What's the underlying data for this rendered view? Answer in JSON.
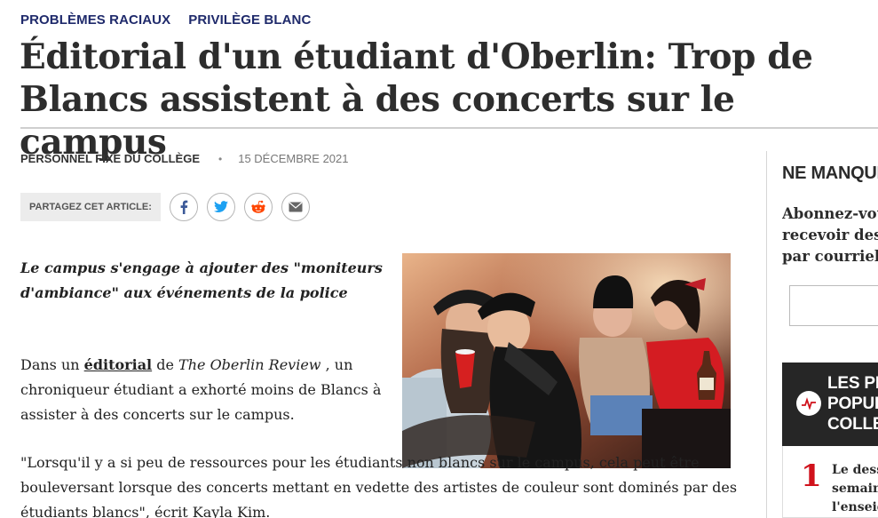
{
  "tags": [
    "PROBLÈMES RACIAUX",
    "PRIVILÈGE BLANC"
  ],
  "article": {
    "title": "Éditorial d'un étudiant d'Oberlin: Trop de Blancs assistent à des concerts sur le campus",
    "author": "PERSONNEL FIXE DU COLLÈGE",
    "separator": "•",
    "date": "15 DÉCEMBRE 2021",
    "lede": "Le campus s'engage à ajouter des \"moniteurs d'ambiance\" aux événements de la police",
    "p1_before": "Dans un ",
    "p1_link": "éditorial",
    "p1_mid": " de ",
    "p1_pub": "The Oberlin Review",
    "p1_after": " , un chroniqueur étudiant a exhorté moins de Blancs à assister à des concerts sur le campus.",
    "p2": "\"Lorsqu'il y a si peu de ressources pour les étudiants non blancs sur le campus, cela peut être bouleversant lorsque des concerts mettant en vedette des artistes de couleur sont dominés par des étudiants blancs\", écrit Kayla Kim."
  },
  "share": {
    "label": "PARTAGEZ CET ARTICLE:",
    "buttons": [
      {
        "icon": "facebook-icon",
        "color": "#3b5998"
      },
      {
        "icon": "twitter-icon",
        "color": "#1da1f2"
      },
      {
        "icon": "reddit-icon",
        "color": "#ff4500"
      },
      {
        "icon": "email-icon",
        "color": "#666666"
      }
    ]
  },
  "sidebar": {
    "heading": "NE MANQUEZ",
    "subscribe_lines": [
      "Abonnez-vous",
      "recevoir des",
      "par courriel"
    ],
    "popular_title_lines": [
      "LES PLUS",
      "POPULAIRES",
      "COLLEGE"
    ],
    "popular_items": [
      {
        "rank": "1",
        "lines": [
          "Le dessin",
          "semaine",
          "l'enseignant"
        ]
      }
    ]
  }
}
